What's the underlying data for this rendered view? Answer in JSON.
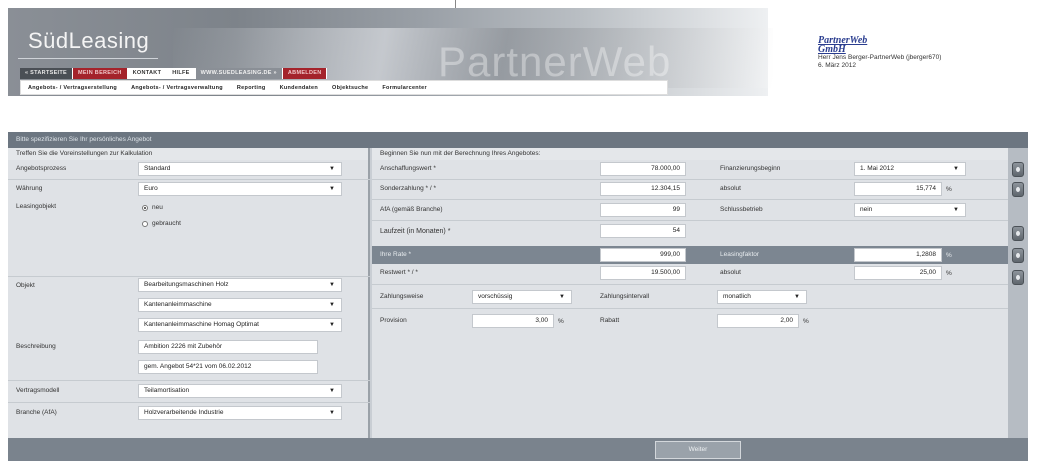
{
  "header": {
    "logo": "SüdLeasing",
    "watermark": "PartnerWeb",
    "nav_top": [
      "« Startseite",
      "Mein Bereich",
      "Kontakt",
      "Hilfe",
      "www.suedleasing.de »",
      "Abmelden"
    ],
    "nav_main": [
      "Angebots- / Vertragserstellung",
      "Angebots- / Vertragsverwaltung",
      "Reporting",
      "Kundendaten",
      "Objektsuche",
      "Formularcenter"
    ],
    "partner_name_line1": "PartnerWeb",
    "partner_name_line2": "GmbH",
    "partner_user": "Herr Jens Berger-PartnerWeb (jberger670)",
    "partner_date": "6. März 2012"
  },
  "page": {
    "bar_text": "Bitte spezifizieren Sie Ihr persönliches Angebot",
    "left_heading": "Treffen Sie die Voreinstellungen zur Kalkulation",
    "right_heading": "Beginnen Sie nun mit der Berechnung Ihres Angebotes:"
  },
  "left": {
    "angebotsprozess_label": "Angebotsprozess",
    "angebotsprozess_value": "Standard",
    "waehrung_label": "Währung",
    "waehrung_value": "Euro",
    "leasingobjekt_label": "Leasingobjekt",
    "radio_neu": "neu",
    "radio_gebraucht": "gebraucht",
    "objekt_label": "Objekt",
    "objekt_value1": "Bearbeitungsmaschinen Holz",
    "objekt_value2": "Kantenanleimmaschine",
    "objekt_value3": "Kantenanleimmaschine Homag Optimat",
    "beschreibung_label": "Beschreibung",
    "beschreibung_value1": "Ambition 2226 mit Zubehör",
    "beschreibung_value2": "gem. Angebot 54*21 vom 06.02.2012",
    "vertragsmodell_label": "Vertragsmodell",
    "vertragsmodell_value": "Teilamortisation",
    "branche_label": "Branche (AfA)",
    "branche_value": "Holzverarbeitende Industrie"
  },
  "right": {
    "anschaffungswert_label": "Anschaffungswert *",
    "anschaffungswert_value": "78.000,00",
    "finanzierungsbeginn_label": "Finanzierungsbeginn",
    "finanzierungsbeginn_value": "1. Mai 2012",
    "sonderzahlung_label": "Sonderzahlung * / *",
    "sonderzahlung_value": "12.304,15",
    "absolut1_label": "absolut",
    "absolut1_value": "15,774",
    "percent": "%",
    "afa_label": "AfA (gemäß Branche)",
    "afa_value": "99",
    "schlussbetrieb_label": "Schlussbetrieb",
    "schlussbetrieb_value": "nein",
    "laufzeit_label": "Laufzeit (in Monaten) *",
    "laufzeit_value": "54",
    "ihre_rate_label": "Ihre Rate *",
    "ihre_rate_value": "999,00",
    "leasingfaktor_label": "Leasingfaktor",
    "leasingfaktor_value": "1,2808",
    "restwert_label": "Restwert * / *",
    "restwert_value": "19.500,00",
    "absolut2_label": "absolut",
    "absolut2_value": "25,00",
    "zahlungsweise_label": "Zahlungsweise",
    "zahlungsweise_value": "vorschüssig",
    "zahlungsintervall_label": "Zahlungsintervall",
    "zahlungsintervall_value": "monatlich",
    "provision_label": "Provision",
    "provision_value": "3,00",
    "rabatt_label": "Rabatt",
    "rabatt_value": "2,00"
  },
  "footer": {
    "weiter_label": "Weiter"
  }
}
